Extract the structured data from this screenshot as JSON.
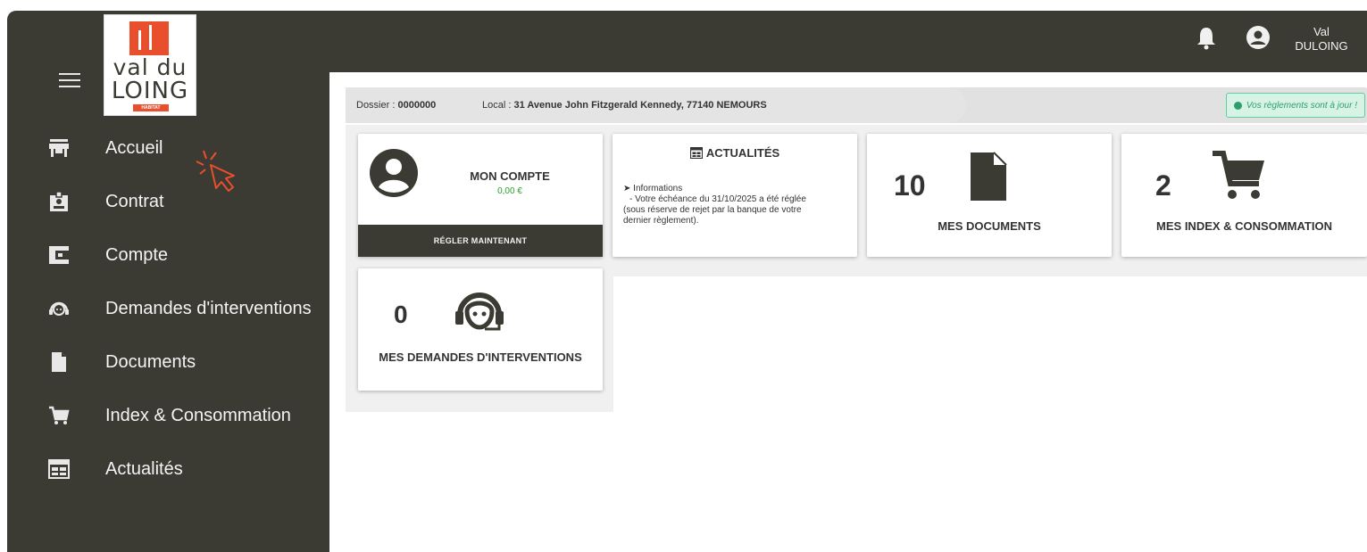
{
  "sidebar": {
    "logo": {
      "line1": "val du",
      "line2": "LOING",
      "tag": "HABITAT"
    },
    "items": [
      {
        "label": "Accueil",
        "icon": "store-icon"
      },
      {
        "label": "Contrat",
        "icon": "badge-icon"
      },
      {
        "label": "Compte",
        "icon": "wallet-icon"
      },
      {
        "label": "Demandes d'interventions",
        "icon": "support-icon"
      },
      {
        "label": "Documents",
        "icon": "document-icon"
      },
      {
        "label": "Index & Consommation",
        "icon": "cart-icon"
      },
      {
        "label": "Actualités",
        "icon": "calendar-icon"
      }
    ]
  },
  "topbar": {
    "user_first": "Val",
    "user_last": "DULOING"
  },
  "infobar": {
    "dossier_label": "Dossier : ",
    "dossier_value": "0000000",
    "local_label": "Local : ",
    "local_value": "31 Avenue John Fitzgerald Kennedy, 77140 NEMOURS",
    "status": "Vos règlements sont à jour !"
  },
  "cards": {
    "compte": {
      "title": "MON COMPTE",
      "amount": "0,00 €",
      "action": "RÉGLER MAINTENANT"
    },
    "actualites": {
      "title": "ACTUALITÉS",
      "item_title": "Informations",
      "item_text_1": "- Votre échéance du 31/10/2025 a été réglée",
      "item_text_2": "(sous réserve de rejet par la banque de votre",
      "item_text_3": "dernier règlement)."
    },
    "documents": {
      "count": "10",
      "label": "MES DOCUMENTS"
    },
    "index": {
      "count": "2",
      "label": "MES INDEX & CONSOMMATION"
    },
    "interventions": {
      "count": "0",
      "label": "MES DEMANDES D'INTERVENTIONS"
    }
  },
  "colors": {
    "dark": "#3b3a33",
    "accent": "#e94e2d",
    "success": "#2e9e6c"
  }
}
